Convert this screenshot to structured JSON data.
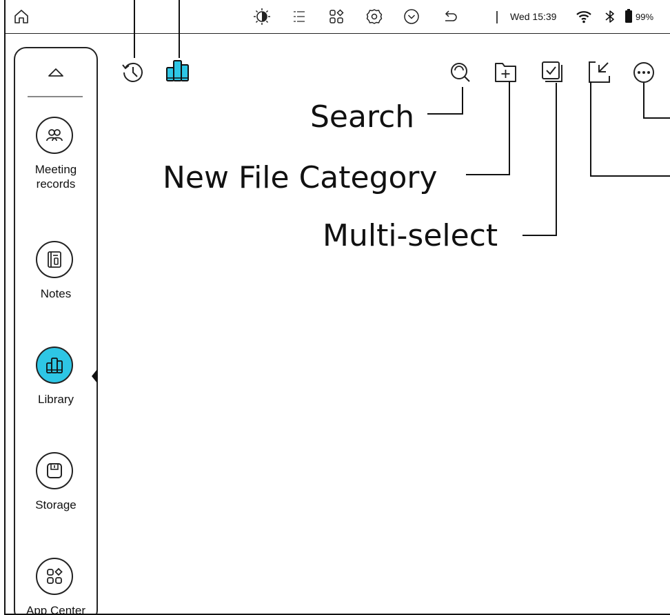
{
  "status_bar": {
    "icons": [
      "home-icon",
      "color-mode-icon",
      "list-icon",
      "apps-icon",
      "settings-icon",
      "dropdown-icon",
      "back-icon",
      "wifi-icon",
      "bluetooth-icon",
      "battery-icon"
    ],
    "datetime": "Wed 15:39",
    "battery": "99%"
  },
  "sidebar": {
    "collapse_icon": "chevron-up-icon",
    "items": [
      {
        "label": "Meeting\nrecords",
        "icon": "people-icon",
        "active": false
      },
      {
        "label": "Notes",
        "icon": "notebook-icon",
        "active": false
      },
      {
        "label": "Library",
        "icon": "books-icon",
        "active": true
      },
      {
        "label": "Storage",
        "icon": "storage-icon",
        "active": false
      },
      {
        "label": "App Center",
        "icon": "app-center-icon",
        "active": false
      }
    ]
  },
  "toolbar": {
    "left_icons": [
      "history-icon",
      "bookshelf-icon"
    ],
    "right_icons": [
      "search-icon",
      "new-folder-icon",
      "multi-select-icon",
      "import-icon",
      "more-icon"
    ]
  },
  "annotations": {
    "search": "Search",
    "new_file_category": "New File Category",
    "multi_select": "Multi-select"
  },
  "colors": {
    "accent": "#2ec6e5",
    "ink": "#111111"
  }
}
